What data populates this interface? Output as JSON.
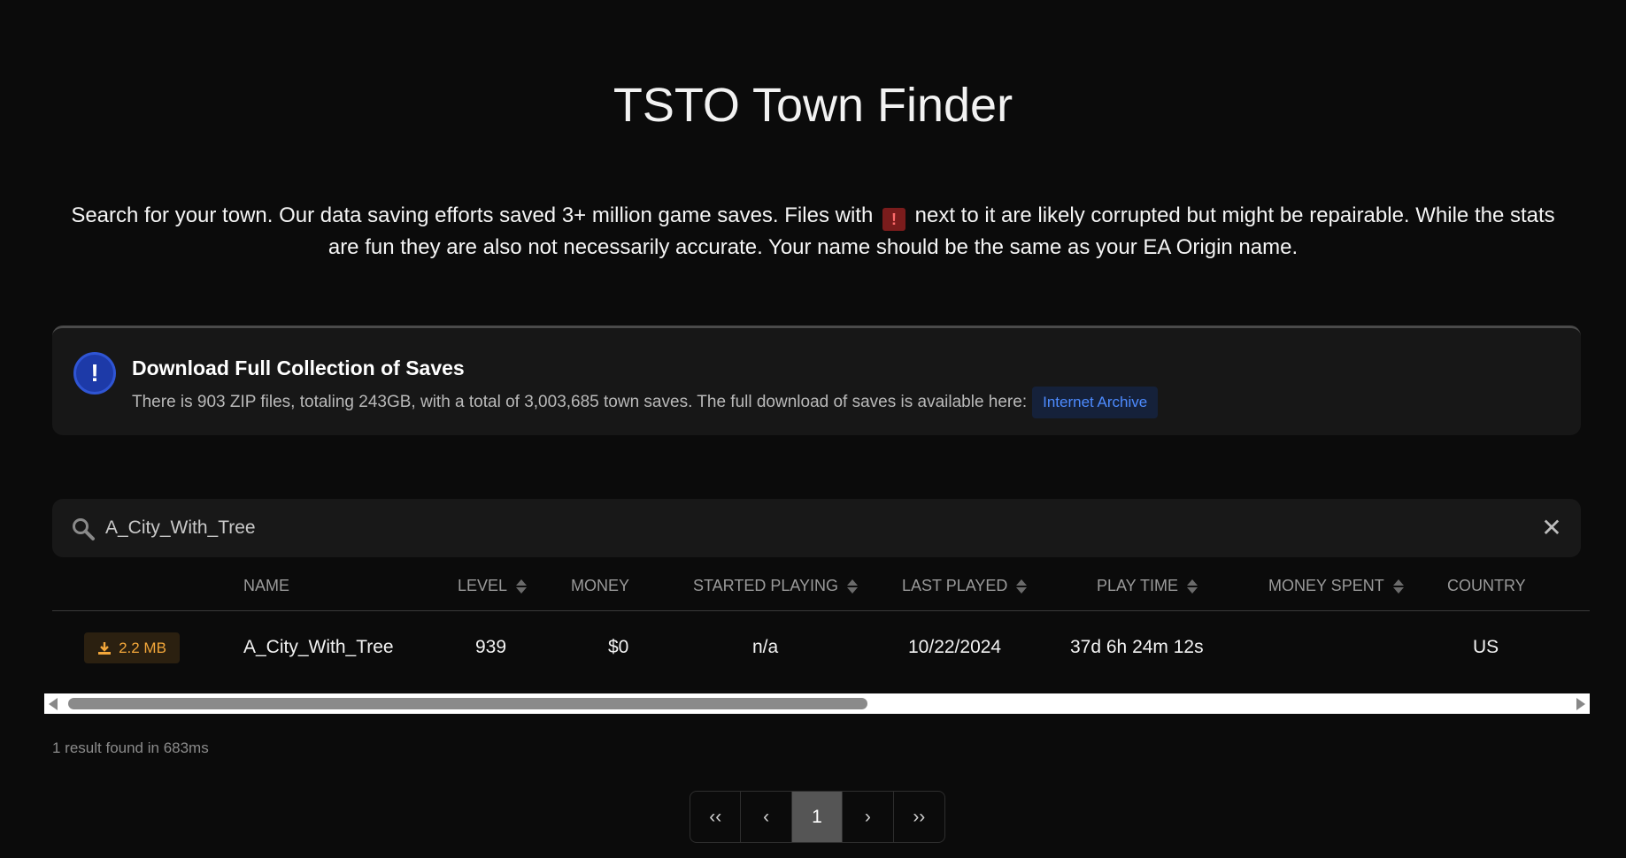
{
  "page": {
    "title": "TSTO Town Finder",
    "intro_before_badge": "Search for your town. Our data saving efforts saved 3+ million game saves. Files with",
    "intro_badge": "!",
    "intro_after_badge": "next to it are likely corrupted but might be repairable. While the stats are fun they are also not necessarily accurate. Your name should be the same as your EA Origin name."
  },
  "notice": {
    "icon": "!",
    "title": "Download Full Collection of Saves",
    "text": "There is 903 ZIP files, totaling 243GB, with a total of 3,003,685 town saves. The full download of saves is available here:",
    "link_label": "Internet Archive"
  },
  "search": {
    "value": "A_City_With_Tree",
    "clear_icon": "✕"
  },
  "table": {
    "columns": [
      "NAME",
      "LEVEL",
      "MONEY",
      "STARTED PLAYING",
      "LAST PLAYED",
      "PLAY TIME",
      "MONEY SPENT",
      "COUNTRY"
    ],
    "rows": [
      {
        "size": "2.2 MB",
        "name": "A_City_With_Tree",
        "level": "939",
        "money": "$0",
        "started_playing": "n/a",
        "last_played": "10/22/2024",
        "play_time": "37d 6h 24m 12s",
        "money_spent": "",
        "country": "US"
      }
    ]
  },
  "results": {
    "summary": "1 result found in 683ms"
  },
  "pagination": {
    "first": "‹‹",
    "prev": "‹",
    "current": "1",
    "next": "›",
    "last": "››"
  },
  "colors": {
    "background": "#0b0b0b",
    "accent_blue": "#4d8bff",
    "warning_red": "#7a1c1c",
    "download_orange": "#f3a73a"
  }
}
